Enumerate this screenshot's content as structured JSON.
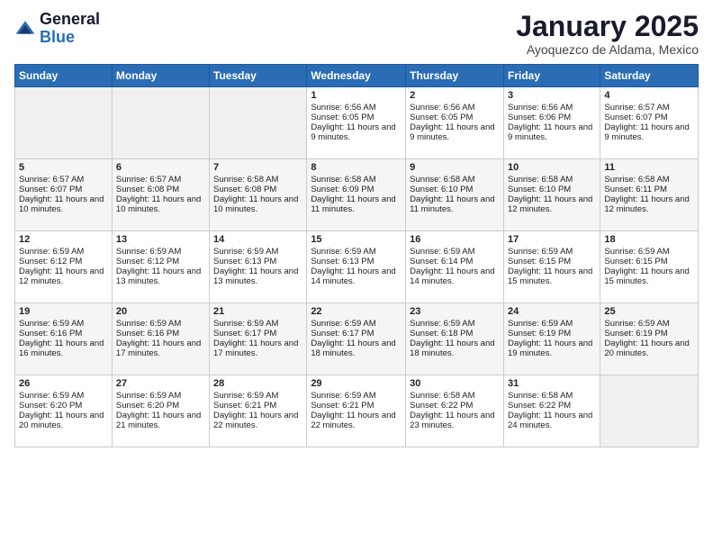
{
  "logo": {
    "general": "General",
    "blue": "Blue"
  },
  "title": "January 2025",
  "location": "Ayoquezco de Aldama, Mexico",
  "days_of_week": [
    "Sunday",
    "Monday",
    "Tuesday",
    "Wednesday",
    "Thursday",
    "Friday",
    "Saturday"
  ],
  "weeks": [
    [
      {
        "day": "",
        "sunrise": "",
        "sunset": "",
        "daylight": ""
      },
      {
        "day": "",
        "sunrise": "",
        "sunset": "",
        "daylight": ""
      },
      {
        "day": "",
        "sunrise": "",
        "sunset": "",
        "daylight": ""
      },
      {
        "day": "1",
        "sunrise": "Sunrise: 6:56 AM",
        "sunset": "Sunset: 6:05 PM",
        "daylight": "Daylight: 11 hours and 9 minutes."
      },
      {
        "day": "2",
        "sunrise": "Sunrise: 6:56 AM",
        "sunset": "Sunset: 6:05 PM",
        "daylight": "Daylight: 11 hours and 9 minutes."
      },
      {
        "day": "3",
        "sunrise": "Sunrise: 6:56 AM",
        "sunset": "Sunset: 6:06 PM",
        "daylight": "Daylight: 11 hours and 9 minutes."
      },
      {
        "day": "4",
        "sunrise": "Sunrise: 6:57 AM",
        "sunset": "Sunset: 6:07 PM",
        "daylight": "Daylight: 11 hours and 9 minutes."
      }
    ],
    [
      {
        "day": "5",
        "sunrise": "Sunrise: 6:57 AM",
        "sunset": "Sunset: 6:07 PM",
        "daylight": "Daylight: 11 hours and 10 minutes."
      },
      {
        "day": "6",
        "sunrise": "Sunrise: 6:57 AM",
        "sunset": "Sunset: 6:08 PM",
        "daylight": "Daylight: 11 hours and 10 minutes."
      },
      {
        "day": "7",
        "sunrise": "Sunrise: 6:58 AM",
        "sunset": "Sunset: 6:08 PM",
        "daylight": "Daylight: 11 hours and 10 minutes."
      },
      {
        "day": "8",
        "sunrise": "Sunrise: 6:58 AM",
        "sunset": "Sunset: 6:09 PM",
        "daylight": "Daylight: 11 hours and 11 minutes."
      },
      {
        "day": "9",
        "sunrise": "Sunrise: 6:58 AM",
        "sunset": "Sunset: 6:10 PM",
        "daylight": "Daylight: 11 hours and 11 minutes."
      },
      {
        "day": "10",
        "sunrise": "Sunrise: 6:58 AM",
        "sunset": "Sunset: 6:10 PM",
        "daylight": "Daylight: 11 hours and 12 minutes."
      },
      {
        "day": "11",
        "sunrise": "Sunrise: 6:58 AM",
        "sunset": "Sunset: 6:11 PM",
        "daylight": "Daylight: 11 hours and 12 minutes."
      }
    ],
    [
      {
        "day": "12",
        "sunrise": "Sunrise: 6:59 AM",
        "sunset": "Sunset: 6:12 PM",
        "daylight": "Daylight: 11 hours and 12 minutes."
      },
      {
        "day": "13",
        "sunrise": "Sunrise: 6:59 AM",
        "sunset": "Sunset: 6:12 PM",
        "daylight": "Daylight: 11 hours and 13 minutes."
      },
      {
        "day": "14",
        "sunrise": "Sunrise: 6:59 AM",
        "sunset": "Sunset: 6:13 PM",
        "daylight": "Daylight: 11 hours and 13 minutes."
      },
      {
        "day": "15",
        "sunrise": "Sunrise: 6:59 AM",
        "sunset": "Sunset: 6:13 PM",
        "daylight": "Daylight: 11 hours and 14 minutes."
      },
      {
        "day": "16",
        "sunrise": "Sunrise: 6:59 AM",
        "sunset": "Sunset: 6:14 PM",
        "daylight": "Daylight: 11 hours and 14 minutes."
      },
      {
        "day": "17",
        "sunrise": "Sunrise: 6:59 AM",
        "sunset": "Sunset: 6:15 PM",
        "daylight": "Daylight: 11 hours and 15 minutes."
      },
      {
        "day": "18",
        "sunrise": "Sunrise: 6:59 AM",
        "sunset": "Sunset: 6:15 PM",
        "daylight": "Daylight: 11 hours and 15 minutes."
      }
    ],
    [
      {
        "day": "19",
        "sunrise": "Sunrise: 6:59 AM",
        "sunset": "Sunset: 6:16 PM",
        "daylight": "Daylight: 11 hours and 16 minutes."
      },
      {
        "day": "20",
        "sunrise": "Sunrise: 6:59 AM",
        "sunset": "Sunset: 6:16 PM",
        "daylight": "Daylight: 11 hours and 17 minutes."
      },
      {
        "day": "21",
        "sunrise": "Sunrise: 6:59 AM",
        "sunset": "Sunset: 6:17 PM",
        "daylight": "Daylight: 11 hours and 17 minutes."
      },
      {
        "day": "22",
        "sunrise": "Sunrise: 6:59 AM",
        "sunset": "Sunset: 6:17 PM",
        "daylight": "Daylight: 11 hours and 18 minutes."
      },
      {
        "day": "23",
        "sunrise": "Sunrise: 6:59 AM",
        "sunset": "Sunset: 6:18 PM",
        "daylight": "Daylight: 11 hours and 18 minutes."
      },
      {
        "day": "24",
        "sunrise": "Sunrise: 6:59 AM",
        "sunset": "Sunset: 6:19 PM",
        "daylight": "Daylight: 11 hours and 19 minutes."
      },
      {
        "day": "25",
        "sunrise": "Sunrise: 6:59 AM",
        "sunset": "Sunset: 6:19 PM",
        "daylight": "Daylight: 11 hours and 20 minutes."
      }
    ],
    [
      {
        "day": "26",
        "sunrise": "Sunrise: 6:59 AM",
        "sunset": "Sunset: 6:20 PM",
        "daylight": "Daylight: 11 hours and 20 minutes."
      },
      {
        "day": "27",
        "sunrise": "Sunrise: 6:59 AM",
        "sunset": "Sunset: 6:20 PM",
        "daylight": "Daylight: 11 hours and 21 minutes."
      },
      {
        "day": "28",
        "sunrise": "Sunrise: 6:59 AM",
        "sunset": "Sunset: 6:21 PM",
        "daylight": "Daylight: 11 hours and 22 minutes."
      },
      {
        "day": "29",
        "sunrise": "Sunrise: 6:59 AM",
        "sunset": "Sunset: 6:21 PM",
        "daylight": "Daylight: 11 hours and 22 minutes."
      },
      {
        "day": "30",
        "sunrise": "Sunrise: 6:58 AM",
        "sunset": "Sunset: 6:22 PM",
        "daylight": "Daylight: 11 hours and 23 minutes."
      },
      {
        "day": "31",
        "sunrise": "Sunrise: 6:58 AM",
        "sunset": "Sunset: 6:22 PM",
        "daylight": "Daylight: 11 hours and 24 minutes."
      },
      {
        "day": "",
        "sunrise": "",
        "sunset": "",
        "daylight": ""
      }
    ]
  ]
}
